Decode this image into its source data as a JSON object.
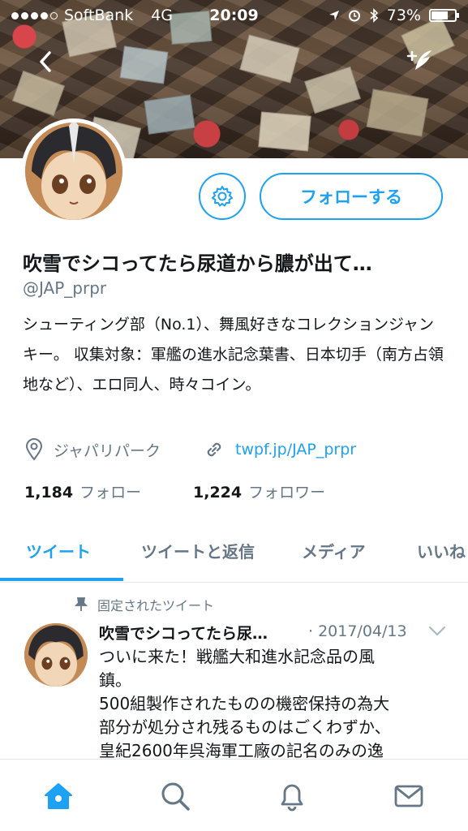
{
  "status_bar": {
    "carrier": "SoftBank",
    "network": "4G",
    "time": "20:09",
    "battery": "73%",
    "battery_level": 0.73
  },
  "header": {
    "back_icon": "chevron-left-icon",
    "compose_icon": "compose-tweet-icon"
  },
  "profile": {
    "name": "吹雪でシコってたら尿道から膿が出て…",
    "handle": "@JAP_prpr",
    "bio": "シューティング部（No.1）、舞風好きなコレクションジャンキー。 収集対象：軍艦の進水記念葉書、日本切手（南方占領地など）、エロ同人、時々コイン。",
    "location": "ジャパリパーク",
    "url": "twpf.jp/JAP_prpr",
    "following_count": "1,184",
    "following_label": "フォロー",
    "followers_count": "1,224",
    "followers_label": "フォロワー",
    "follow_button": "フォローする"
  },
  "tabs": [
    {
      "label": "ツイート",
      "active": true
    },
    {
      "label": "ツイートと返信",
      "active": false
    },
    {
      "label": "メディア",
      "active": false
    },
    {
      "label": "いいね",
      "active": false
    }
  ],
  "pinned_tweet": {
    "pinned_label": "固定されたツイート",
    "author": "吹雪でシコってたら尿…",
    "date": "· 2017/04/13",
    "text_lines": [
      "ついに来た！戦艦大和進水記念品の風",
      "鎮。",
      "500組製作されたものの機密保持の為大",
      "部分が処分され残るものはごくわずか、",
      "皇紀2600年呉海軍工廠の記名のみの逸"
    ]
  },
  "tab_bar": {
    "items": [
      "home-icon",
      "search-icon",
      "notifications-icon",
      "messages-icon"
    ]
  },
  "colors": {
    "accent": "#1da1f2",
    "secondary_text": "#657786",
    "primary_text": "#14171a"
  }
}
